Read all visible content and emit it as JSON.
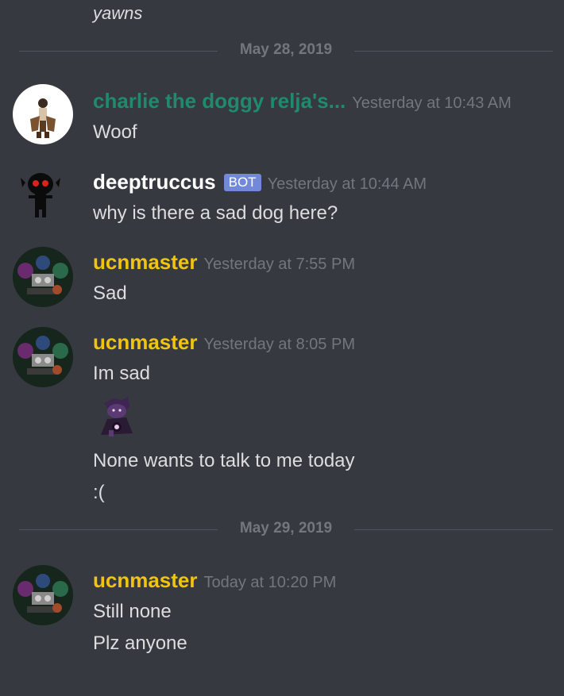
{
  "top_message": {
    "text": "yawns"
  },
  "dividers": [
    {
      "date": "May 28, 2019"
    },
    {
      "date": "May 29, 2019"
    }
  ],
  "messages": [
    {
      "author": "charlie the doggy relja's...",
      "author_color": "#1f8b6c",
      "timestamp": "Yesterday at 10:43 AM",
      "lines": [
        "Woof"
      ]
    },
    {
      "author": "deeptruccus",
      "author_color": "#ffffff",
      "badge": "BOT",
      "timestamp": "Yesterday at 10:44 AM",
      "lines": [
        "why is there a sad dog here?"
      ]
    },
    {
      "author": "ucnmaster",
      "author_color": "#f1c40f",
      "timestamp": "Yesterday at 7:55 PM",
      "lines": [
        "Sad"
      ]
    },
    {
      "author": "ucnmaster",
      "author_color": "#f1c40f",
      "timestamp": "Yesterday at 8:05 PM",
      "lines": [
        "Im sad",
        "None wants to talk to me today",
        ":("
      ],
      "attachment_icon": "sad-character-emoji"
    },
    {
      "author": "ucnmaster",
      "author_color": "#f1c40f",
      "timestamp": "Today at 10:20 PM",
      "lines": [
        "Still none",
        "Plz anyone"
      ]
    }
  ]
}
